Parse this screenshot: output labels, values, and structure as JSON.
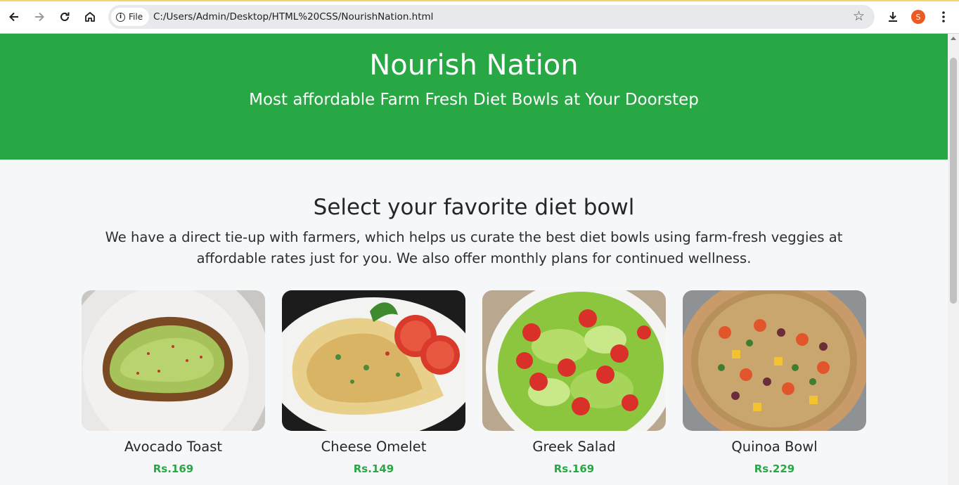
{
  "browser": {
    "file_chip": "File",
    "url": "C:/Users/Admin/Desktop/HTML%20CSS/NourishNation.html",
    "avatar_letter": "S",
    "accent_color": "#ea5a21"
  },
  "hero": {
    "title": "Nourish Nation",
    "subtitle": "Most affordable Farm Fresh Diet Bowls at Your Doorstep",
    "background_color": "#28a745"
  },
  "section": {
    "heading": "Select your favorite diet bowl",
    "description": "We have a direct tie-up with farmers, which helps us curate the best diet bowls using farm-fresh veggies at affordable rates just for you. We also offer monthly plans for continued wellness."
  },
  "bowls": [
    {
      "name": "Avocado Toast",
      "price": "Rs.169"
    },
    {
      "name": "Cheese Omelet",
      "price": "Rs.149"
    },
    {
      "name": "Greek Salad",
      "price": "Rs.169"
    },
    {
      "name": "Quinoa Bowl",
      "price": "Rs.229"
    }
  ],
  "icons": {
    "back": "arrow-left-icon",
    "forward": "arrow-right-icon",
    "reload": "reload-icon",
    "home": "home-icon",
    "info": "info-icon",
    "bookmark": "star-icon",
    "download": "download-icon",
    "menu": "kebab-menu-icon"
  }
}
